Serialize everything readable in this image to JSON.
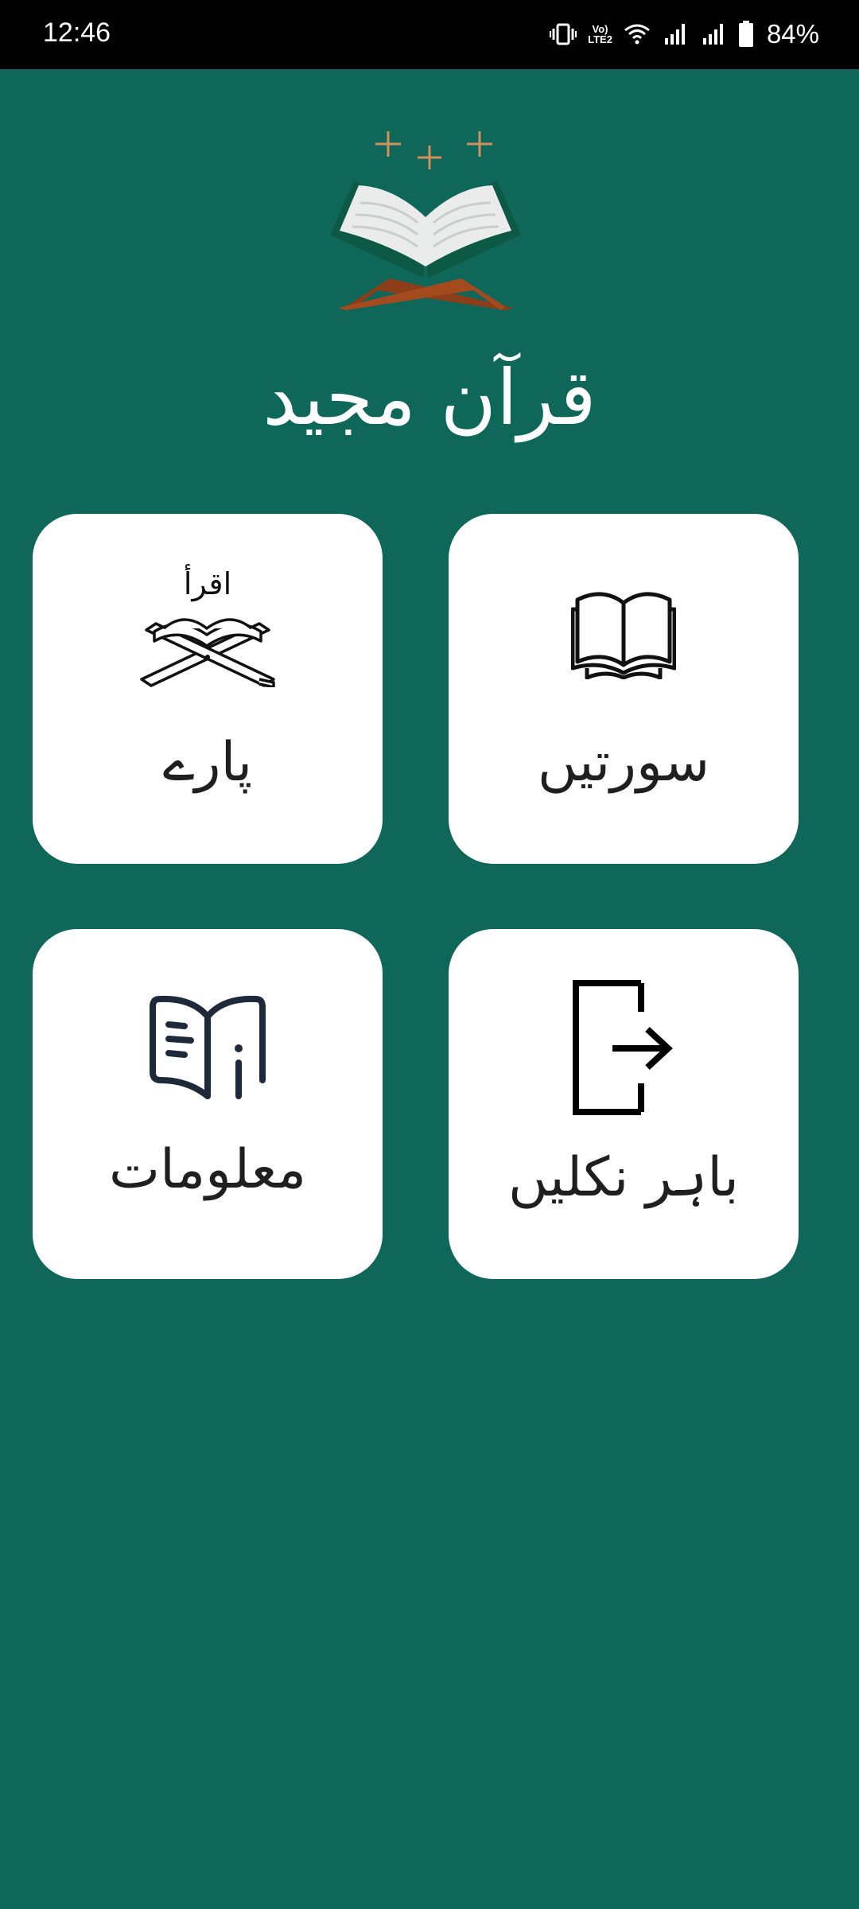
{
  "status_bar": {
    "time": "12:46",
    "volte_label": "Vo)\nLTE2",
    "battery_percent": "84%",
    "icons": [
      "vibrate-icon",
      "volte-icon",
      "wifi-icon",
      "signal-icon",
      "signal-icon",
      "battery-icon"
    ]
  },
  "app": {
    "title": "قرآن مجید",
    "logo_icon": "quran-book-on-stand-icon"
  },
  "menu": {
    "surahs": {
      "label": "سورتیں",
      "icon": "open-book-icon"
    },
    "paras": {
      "label": "پارے",
      "icon": "iqra-quran-stand-icon",
      "icon_text": "اقرأ"
    },
    "exit": {
      "label": "باہر نکلیں",
      "icon": "exit-door-icon"
    },
    "info": {
      "label": "معلومات",
      "icon": "info-book-icon"
    }
  },
  "colors": {
    "background": "#0f675a",
    "card": "#ffffff",
    "book_cover": "#0c5a45",
    "stand": "#8b3e18",
    "sparkle": "#d4905c"
  }
}
